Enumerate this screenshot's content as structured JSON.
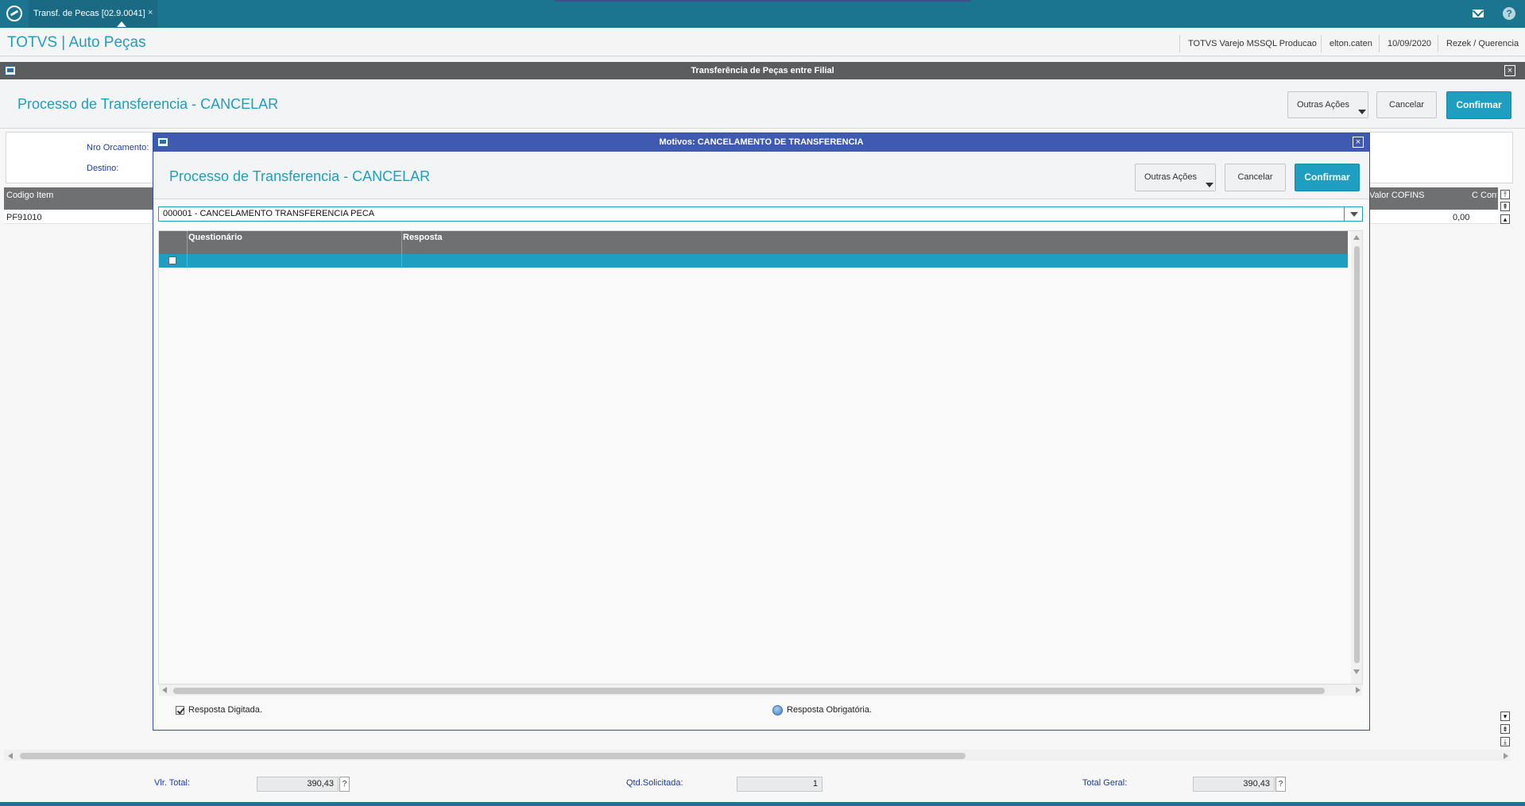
{
  "topbar": {
    "tab_title": "Transf. de Pecas [02.9.0041]",
    "tab_close": "×",
    "help_label": "?"
  },
  "app": {
    "title": "TOTVS | Auto Peças",
    "info": [
      "TOTVS Varejo MSSQL Producao",
      "elton.caten",
      "10/09/2020",
      "Rezek / Querencia"
    ]
  },
  "outer_window": {
    "title": "Transferência de Peças entre Filial",
    "close": "×",
    "page_title": "Processo de Transferencia - CANCELAR",
    "buttons": {
      "other": "Outras Ações",
      "cancel": "Cancelar",
      "confirm": "Confirmar"
    },
    "form": {
      "nro_orcamento_label": "Nro Orcamento:",
      "destino_label": "Destino:"
    },
    "grid": {
      "headers": [
        "Codigo Item",
        "Valor COFINS",
        "C Cont"
      ],
      "row": {
        "codigo": "PF91010",
        "valor_cofins": "0,00"
      }
    },
    "footer": {
      "vlr_total_label": "Vlr. Total:",
      "vlr_total_value": "390,43",
      "qtd_label": "Qtd.Solicitada:",
      "qtd_value": "1",
      "total_geral_label": "Total Geral:",
      "total_geral_value": "390,43",
      "help": "?"
    }
  },
  "modal": {
    "title": "Motivos: CANCELAMENTO DE TRANSFERENCIA",
    "close": "×",
    "page_title": "Processo de Transferencia - CANCELAR",
    "buttons": {
      "other": "Outras Ações",
      "cancel": "Cancelar",
      "confirm": "Confirmar"
    },
    "combo_value": "000001 - CANCELAMENTO TRANSFERENCIA PECA",
    "grid_headers": {
      "questionario": "Questionário",
      "resposta": "Resposta"
    },
    "legend": {
      "typed": "Resposta Digitada.",
      "required": "Resposta Obrigatória."
    }
  }
}
